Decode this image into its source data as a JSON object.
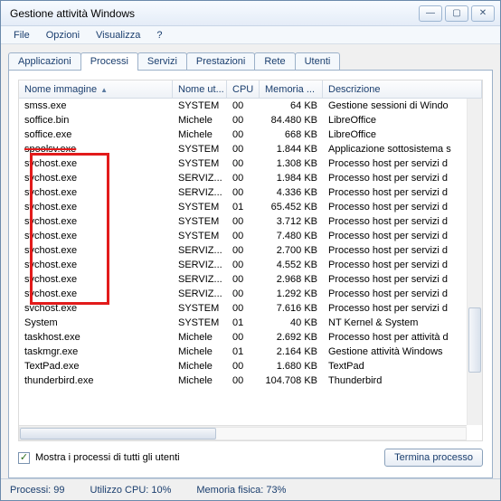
{
  "window": {
    "title": "Gestione attività Windows"
  },
  "window_controls": {
    "min": "—",
    "max": "▢",
    "close": "✕"
  },
  "menu": {
    "file": "File",
    "options": "Opzioni",
    "view": "Visualizza",
    "help": "?"
  },
  "tabs": [
    {
      "id": "apps",
      "label": "Applicazioni"
    },
    {
      "id": "proc",
      "label": "Processi"
    },
    {
      "id": "serv",
      "label": "Servizi"
    },
    {
      "id": "perf",
      "label": "Prestazioni"
    },
    {
      "id": "net",
      "label": "Rete"
    },
    {
      "id": "users",
      "label": "Utenti"
    }
  ],
  "active_tab": "proc",
  "columns": {
    "name": "Nome immagine",
    "user": "Nome ut...",
    "cpu": "CPU",
    "mem": "Memoria ...",
    "desc": "Descrizione"
  },
  "rows": [
    {
      "name": "smss.exe",
      "user": "SYSTEM",
      "cpu": "00",
      "mem": "64 KB",
      "desc": "Gestione sessioni di Windo"
    },
    {
      "name": "soffice.bin",
      "user": "Michele",
      "cpu": "00",
      "mem": "84.480 KB",
      "desc": "LibreOffice"
    },
    {
      "name": "soffice.exe",
      "user": "Michele",
      "cpu": "00",
      "mem": "668 KB",
      "desc": "LibreOffice"
    },
    {
      "name": "spoolsv.exe",
      "user": "SYSTEM",
      "cpu": "00",
      "mem": "1.844 KB",
      "desc": "Applicazione sottosistema s",
      "strike": true
    },
    {
      "name": "svchost.exe",
      "user": "SYSTEM",
      "cpu": "00",
      "mem": "1.308 KB",
      "desc": "Processo host per servizi d"
    },
    {
      "name": "svchost.exe",
      "user": "SERVIZ...",
      "cpu": "00",
      "mem": "1.984 KB",
      "desc": "Processo host per servizi d"
    },
    {
      "name": "svchost.exe",
      "user": "SERVIZ...",
      "cpu": "00",
      "mem": "4.336 KB",
      "desc": "Processo host per servizi d"
    },
    {
      "name": "svchost.exe",
      "user": "SYSTEM",
      "cpu": "01",
      "mem": "65.452 KB",
      "desc": "Processo host per servizi d"
    },
    {
      "name": "svchost.exe",
      "user": "SYSTEM",
      "cpu": "00",
      "mem": "3.712 KB",
      "desc": "Processo host per servizi d"
    },
    {
      "name": "svchost.exe",
      "user": "SYSTEM",
      "cpu": "00",
      "mem": "7.480 KB",
      "desc": "Processo host per servizi d"
    },
    {
      "name": "svchost.exe",
      "user": "SERVIZ...",
      "cpu": "00",
      "mem": "2.700 KB",
      "desc": "Processo host per servizi d"
    },
    {
      "name": "svchost.exe",
      "user": "SERVIZ...",
      "cpu": "00",
      "mem": "4.552 KB",
      "desc": "Processo host per servizi d"
    },
    {
      "name": "svchost.exe",
      "user": "SERVIZ...",
      "cpu": "00",
      "mem": "2.968 KB",
      "desc": "Processo host per servizi d"
    },
    {
      "name": "svchost.exe",
      "user": "SERVIZ...",
      "cpu": "00",
      "mem": "1.292 KB",
      "desc": "Processo host per servizi d"
    },
    {
      "name": "svchost.exe",
      "user": "SYSTEM",
      "cpu": "00",
      "mem": "7.616 KB",
      "desc": "Processo host per servizi d"
    },
    {
      "name": "System",
      "user": "SYSTEM",
      "cpu": "01",
      "mem": "40 KB",
      "desc": "NT Kernel & System"
    },
    {
      "name": "taskhost.exe",
      "user": "Michele",
      "cpu": "00",
      "mem": "2.692 KB",
      "desc": "Processo host per attività d"
    },
    {
      "name": "taskmgr.exe",
      "user": "Michele",
      "cpu": "01",
      "mem": "2.164 KB",
      "desc": "Gestione attività Windows"
    },
    {
      "name": "TextPad.exe",
      "user": "Michele",
      "cpu": "00",
      "mem": "1.680 KB",
      "desc": "TextPad"
    },
    {
      "name": "thunderbird.exe",
      "user": "Michele",
      "cpu": "00",
      "mem": "104.708 KB",
      "desc": "Thunderbird"
    }
  ],
  "checkbox": {
    "label": "Mostra i processi di tutti gli utenti",
    "checked": true
  },
  "end_button": "Termina processo",
  "status": {
    "procs": "Processi: 99",
    "cpu": "Utilizzo CPU: 10%",
    "mem": "Memoria fisica: 73%"
  }
}
